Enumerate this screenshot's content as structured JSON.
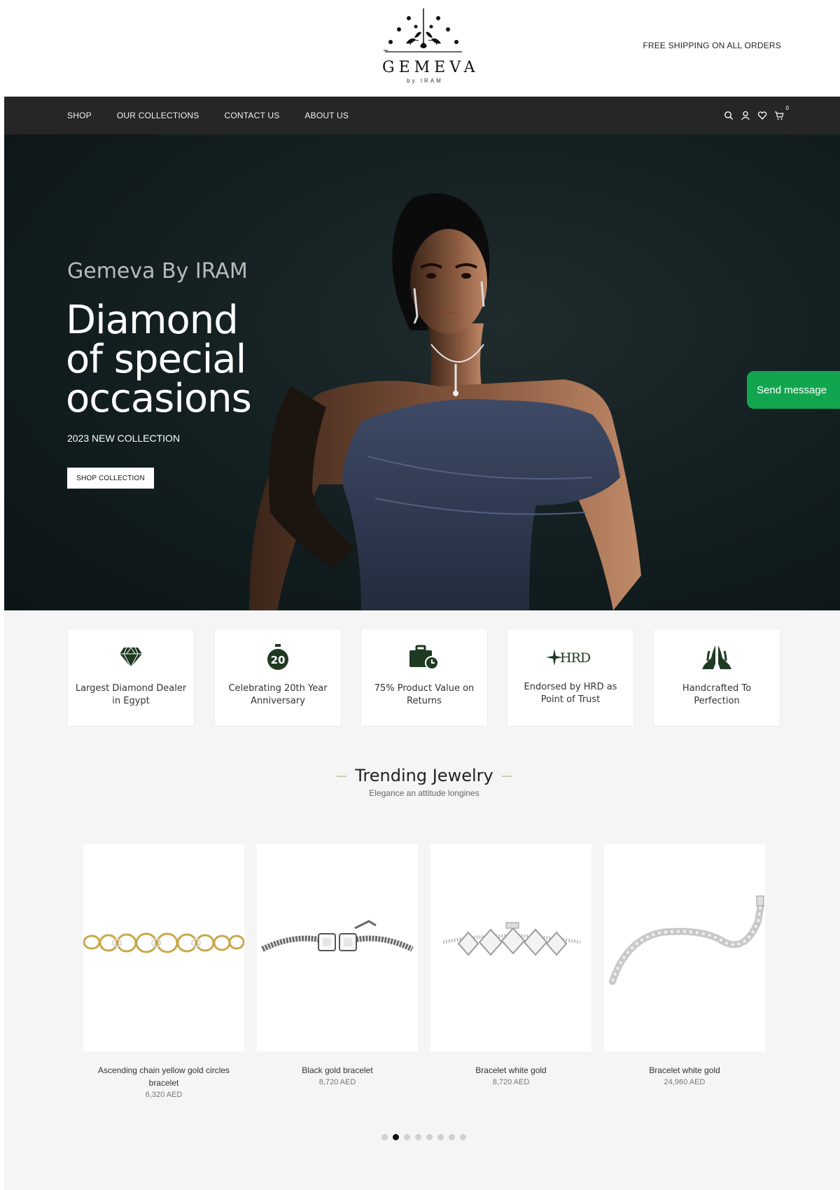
{
  "header": {
    "logo_word": "GEMEVA",
    "logo_sub": "by IRAM",
    "shipping_note": "FREE SHIPPING ON ALL ORDERS"
  },
  "nav": {
    "links": [
      "SHOP",
      "OUR COLLECTIONS",
      "CONTACT US",
      "ABOUT US"
    ],
    "icons": [
      "search-icon",
      "user-icon",
      "heart-icon",
      "cart-icon"
    ],
    "cart_count": "0"
  },
  "hero": {
    "eyebrow": "Gemeva By IRAM",
    "title_line1": "Diamond",
    "title_line2": "of special",
    "title_line3": "occasions",
    "subtitle": "2023 NEW COLLECTION",
    "button": "SHOP COLLECTION"
  },
  "chat": {
    "button": "Send message",
    "color": "#12a54f"
  },
  "features": [
    {
      "icon": "diamond-icon",
      "text": "Largest Diamond Dealer in Egypt"
    },
    {
      "icon": "stopwatch-20-icon",
      "text": "Celebrating 20th Year Anniversary",
      "badge": "20"
    },
    {
      "icon": "briefcase-clock-icon",
      "text": "75% Product Value on Returns"
    },
    {
      "icon": "hrd-logo-icon",
      "text": "Endorsed by HRD as Point of Trust",
      "badge": "HRD"
    },
    {
      "icon": "praying-hands-icon",
      "text": "Handcrafted To Perfection"
    }
  ],
  "trending": {
    "title": "Trending Jewelry",
    "subtitle": "Elegance an attitude longines",
    "products": [
      {
        "name": "Ascending chain yellow gold circles bracelet",
        "price": "6,320 AED"
      },
      {
        "name": "Black gold bracelet",
        "price": "8,720 AED"
      },
      {
        "name": "Bracelet white gold",
        "price": "8,720 AED"
      },
      {
        "name": "Bracelet white gold",
        "price": "24,960 AED"
      }
    ],
    "pagination": {
      "total": 8,
      "active": 1
    }
  },
  "colors": {
    "nav_bg": "#262626",
    "accent_green": "#1f3a22",
    "hero_bg": "#142022"
  }
}
